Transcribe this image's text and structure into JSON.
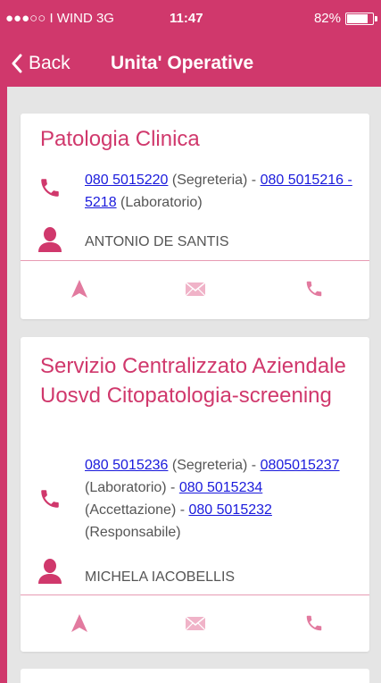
{
  "status_bar": {
    "carrier": "●●●○○ I WIND  3G",
    "time": "11:47",
    "battery": "82%",
    "battery_level": 0.82
  },
  "nav": {
    "back_label": "Back",
    "title": "Unita' Operative"
  },
  "cards": [
    {
      "title": "Patologia Clinica",
      "phones": [
        {
          "number": "080 5015220",
          "label": " (Segreteria) - "
        },
        {
          "number": "080 5015216 - 5218",
          "label": " (Laboratorio)"
        }
      ],
      "person": "ANTONIO DE SANTIS"
    },
    {
      "title": "Servizio Centralizzato Aziendale Uosvd Citopatologia-screening",
      "phones": [
        {
          "number": "080 5015236",
          "label": " (Segreteria) - "
        },
        {
          "number": "0805015237",
          "label": " (Laboratorio) - "
        },
        {
          "number": "080 5015234",
          "label": " (Accettazione) - "
        },
        {
          "number": "080 5015232",
          "label": " (Responsabile)"
        }
      ],
      "person": "MICHELA IACOBELLIS"
    }
  ],
  "colors": {
    "brand": "#d0386c",
    "action_icon": "#e27a9f",
    "link": "#1a1adc"
  },
  "icons": [
    "back-chevron-icon",
    "phone-icon",
    "person-icon",
    "navigate-arrow-icon",
    "mail-icon",
    "call-icon"
  ]
}
